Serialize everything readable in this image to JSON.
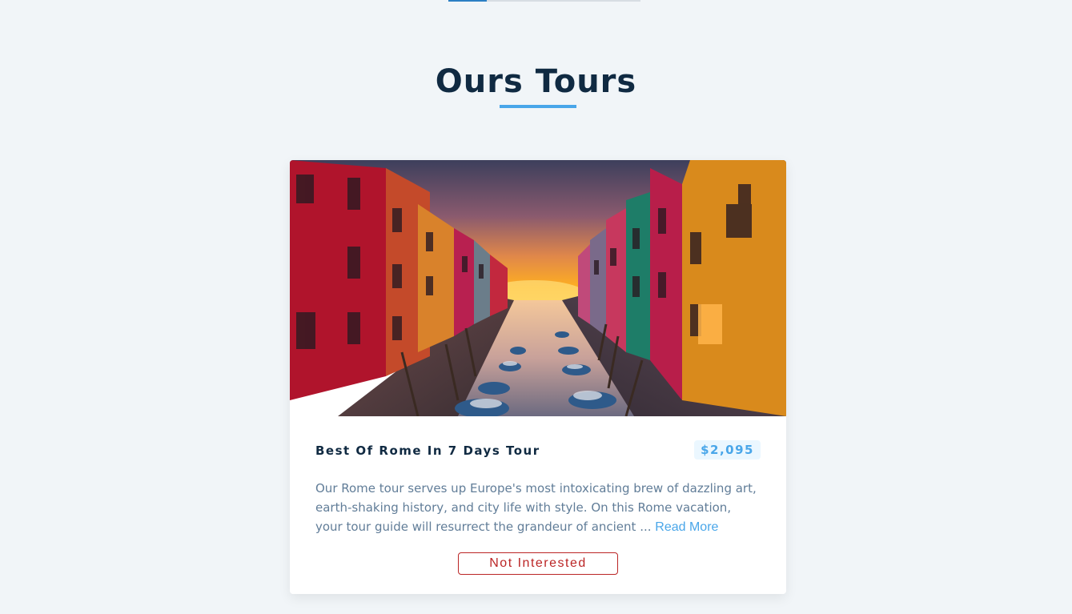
{
  "section": {
    "title": "Ours Tours"
  },
  "tour": {
    "name": "Best Of Rome In 7 Days Tour",
    "price": "$2,095",
    "description": "Our Rome tour serves up Europe's most intoxicating brew of dazzling art, earth-shaking history, and city life with style. On this Rome vacation, your tour guide will resurrect the grandeur of ancient ...",
    "read_more_label": "Read More",
    "not_interested_label": "Not Interested",
    "image_alt": "canal-sunset-photo"
  },
  "colors": {
    "accent": "#49a6e9",
    "heading": "#102a42",
    "danger": "#bb2525",
    "body_text": "#617d98",
    "background": "#f1f5f8"
  }
}
